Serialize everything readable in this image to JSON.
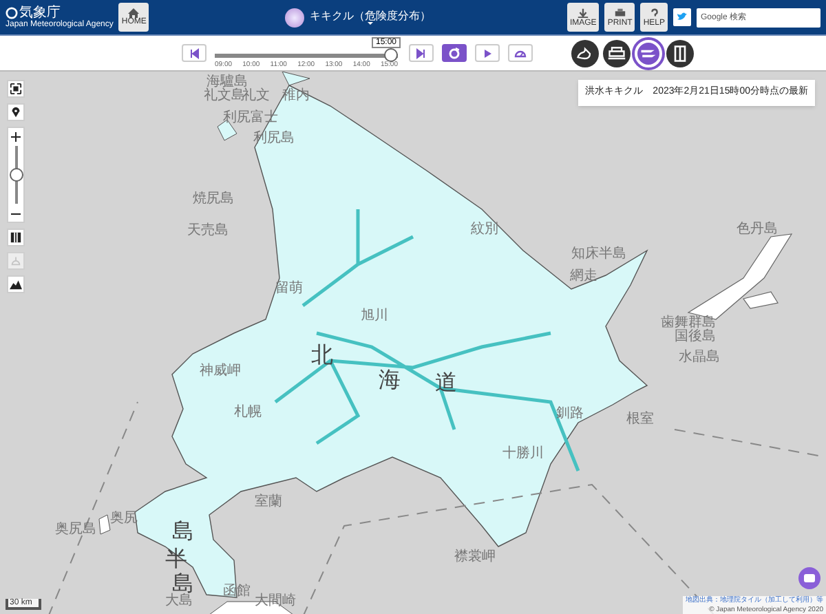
{
  "header": {
    "logo": "気象庁",
    "logo_sub": "Japan Meteorological Agency",
    "home": "HOME",
    "title": "キキクル（危険度分布）",
    "tools": [
      {
        "label": "IMAGE",
        "kind": "download"
      },
      {
        "label": "PRINT",
        "kind": "print"
      },
      {
        "label": "HELP",
        "kind": "help"
      }
    ],
    "search": {
      "placeholder": "Google 検索"
    }
  },
  "timeline": {
    "current": "15:00",
    "level": 1,
    "ticks": [
      "09:00",
      "10:00",
      "11:00",
      "12:00",
      "13:00",
      "14:00",
      "15:00"
    ],
    "buttons": [
      {
        "kind": "first",
        "selected": false
      },
      {
        "kind": "last",
        "selected": false
      },
      {
        "kind": "latest",
        "selected": true
      },
      {
        "kind": "play",
        "selected": false
      },
      {
        "kind": "speed",
        "selected": false
      }
    ],
    "layers": [
      {
        "kind": "landslide",
        "selected": false
      },
      {
        "kind": "inundation",
        "selected": false
      },
      {
        "kind": "flood",
        "selected": true
      },
      {
        "kind": "book",
        "selected": false
      }
    ]
  },
  "map": {
    "info": "洪水キキクル　2023年2月21日15時00分時点の最新",
    "zoom": {
      "level": 0.5
    },
    "controls": [
      {
        "kind": "fullscreen",
        "disabled": false
      },
      {
        "kind": "location",
        "disabled": false
      },
      {
        "kind": "map",
        "disabled": false
      },
      {
        "kind": "terrain",
        "disabled": true
      },
      {
        "kind": "mountain",
        "disabled": false
      }
    ],
    "labels": [
      "海驢島",
      "礼文島",
      "礼文",
      "利尻富士",
      "利尻島",
      "稚内",
      "焼尻島",
      "天売島",
      "留萌",
      "紋別",
      "網走",
      "知床半島",
      "国後島",
      "色丹島",
      "歯舞群島",
      "水晶島",
      "釧路",
      "根室",
      "北",
      "海",
      "道",
      "旭川",
      "札幌",
      "室蘭",
      "函館",
      "奥尻",
      "奥尻島",
      "島",
      "半",
      "島",
      "襟裳岬",
      "大島",
      "大間崎",
      "神威岬",
      "十勝川"
    ],
    "scale": "30 km",
    "attribution": "地図出典：地理院タイル（加工して利用）等",
    "copyright": "© Japan Meteorological Agency 2020"
  }
}
